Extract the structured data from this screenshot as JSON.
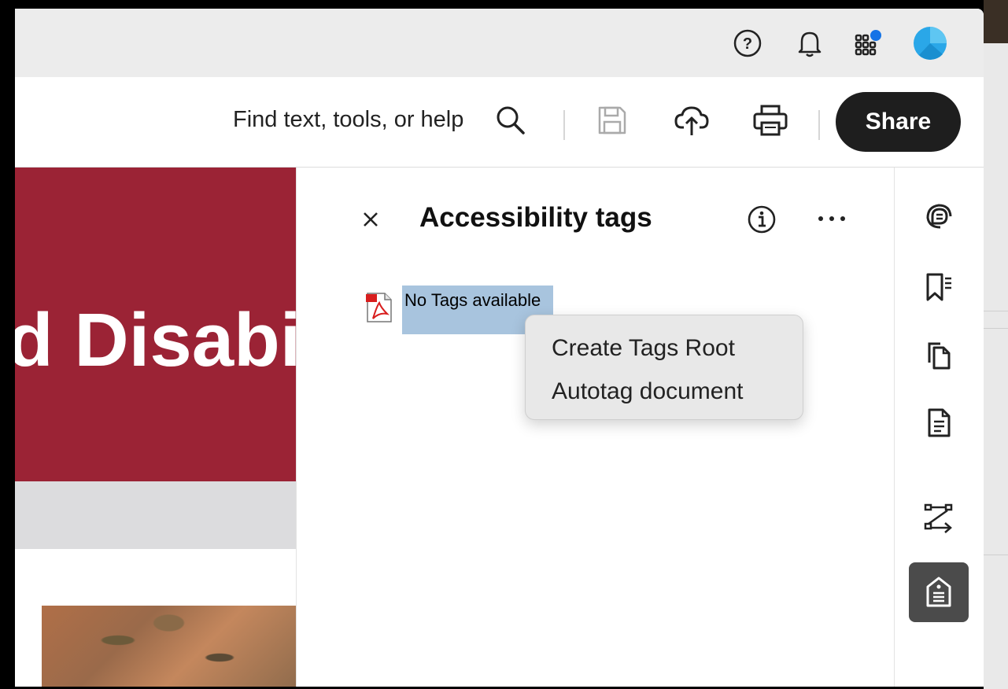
{
  "topbar": {
    "icons": [
      "help-icon",
      "notification-bell-icon",
      "apps-grid-icon",
      "user-avatar"
    ]
  },
  "toolbar": {
    "search_placeholder": "Find text, tools, or help",
    "icons": [
      "search-icon",
      "save-icon",
      "cloud-upload-icon",
      "print-icon"
    ],
    "share_label": "Share"
  },
  "document": {
    "banner_text": "d Disabi",
    "banner_color": "#9b2335"
  },
  "panel": {
    "title": "Accessibility tags",
    "tree_item_label": "No Tags available"
  },
  "context_menu": {
    "items": [
      {
        "label": "Create Tags Root"
      },
      {
        "label": "Autotag document"
      }
    ]
  },
  "rail": {
    "icons": [
      "comment-icon",
      "bookmark-list-icon",
      "pages-icon",
      "document-icon",
      "reading-order-icon",
      "accessibility-tag-icon"
    ],
    "active": "accessibility-tag-icon"
  },
  "colors": {
    "share_bg": "#1e1e1e",
    "selection": "#a8c4de",
    "avatar": "#2aa7e8",
    "apps_badge": "#1473e6"
  }
}
